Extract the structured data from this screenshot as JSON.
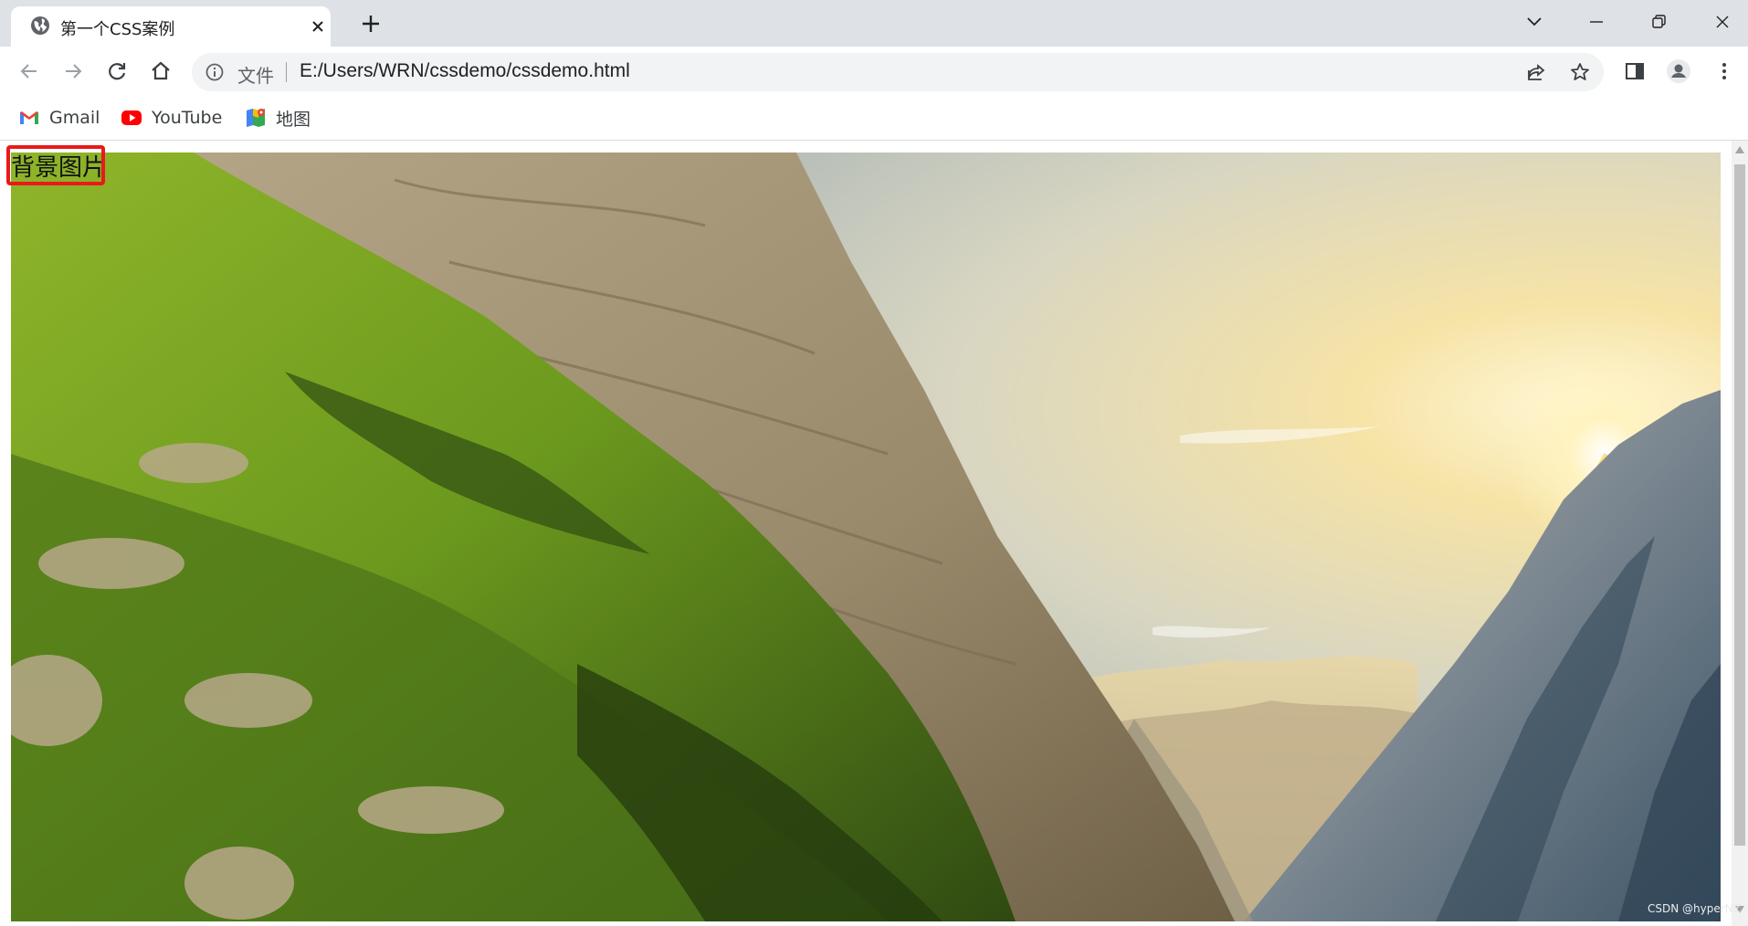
{
  "browser": {
    "tab": {
      "title": "第一个CSS案例",
      "favicon": "globe-icon"
    },
    "window_controls": [
      "tab-search-icon",
      "minimize-icon",
      "restore-icon",
      "close-icon"
    ]
  },
  "toolbar": {
    "address": {
      "scheme_label": "文件",
      "url": "E:/Users/WRN/cssdemo/cssdemo.html"
    }
  },
  "bookmarks": [
    {
      "label": "Gmail",
      "icon": "gmail-icon"
    },
    {
      "label": "YouTube",
      "icon": "youtube-icon"
    },
    {
      "label": "地图",
      "icon": "maps-icon"
    }
  ],
  "page": {
    "text": "背景图片",
    "background": "mountain-sunrise-photo",
    "highlight_color": "#e8191b"
  },
  "watermark": "CSDN @hyperNZ"
}
